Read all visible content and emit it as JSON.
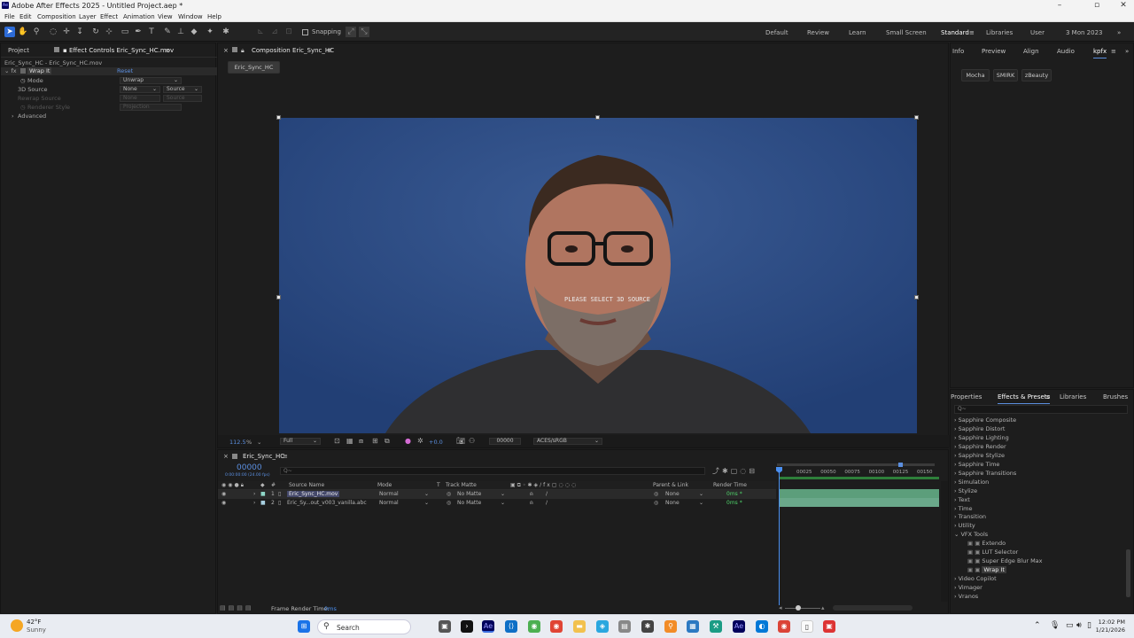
{
  "window": {
    "title": "Adobe After Effects 2025 - Untitled Project.aep *",
    "app_icon": "Ae"
  },
  "menu": [
    "File",
    "Edit",
    "Composition",
    "Layer",
    "Effect",
    "Animation",
    "View",
    "Window",
    "Help"
  ],
  "toolbar": {
    "snapping_label": "Snapping"
  },
  "workspaces": [
    "Default",
    "Review",
    "Learn",
    "Small Screen",
    "Standard",
    "Libraries",
    "User",
    "3 Mon 2023"
  ],
  "active_workspace": "Standard",
  "left_panel": {
    "tabs": [
      "Project",
      "Effect Controls Eric_Sync_HC.mov"
    ],
    "breadcrumb": "Eric_Sync_HC - Eric_Sync_HC.mov",
    "effect_name": "Wrap It",
    "reset_label": "Reset",
    "props": [
      {
        "label": "Mode",
        "value": "Unwrap"
      },
      {
        "label": "3D Source",
        "value": "None",
        "value2": "Source"
      },
      {
        "label": "Rewrap Source",
        "value": "None",
        "value2": "Source"
      },
      {
        "label": "Renderer Style",
        "value": "Projection"
      },
      {
        "label": "Advanced"
      }
    ]
  },
  "comp_panel": {
    "tab": "Composition Eric_Sync_HC",
    "comp_button": "Eric_Sync_HC",
    "overlay_text": "PLEASE SELECT 3D SOURCE",
    "zoom": "112.5",
    "zoom_unit": "%",
    "resolution": "Full",
    "exposure": "+0.0",
    "timecode": "00000",
    "color_space": "ACES/sRGB"
  },
  "right_panel": {
    "tabs": [
      "Info",
      "Preview",
      "Align",
      "Audio",
      "kpfx"
    ],
    "buttons": [
      "Mocha",
      "SMIRK",
      "zBeauty"
    ],
    "lower_tabs": [
      "Properties",
      "Effects & Presets",
      "Libraries",
      "Brushes"
    ],
    "search_placeholder": "Q~",
    "effects_list": [
      {
        "label": "Sapphire Composite",
        "indent": 0
      },
      {
        "label": "Sapphire Distort",
        "indent": 0
      },
      {
        "label": "Sapphire Lighting",
        "indent": 0
      },
      {
        "label": "Sapphire Render",
        "indent": 0
      },
      {
        "label": "Sapphire Stylize",
        "indent": 0
      },
      {
        "label": "Sapphire Time",
        "indent": 0
      },
      {
        "label": "Sapphire Transitions",
        "indent": 0
      },
      {
        "label": "Simulation",
        "indent": 0
      },
      {
        "label": "Stylize",
        "indent": 0
      },
      {
        "label": "Text",
        "indent": 0
      },
      {
        "label": "Time",
        "indent": 0
      },
      {
        "label": "Transition",
        "indent": 0
      },
      {
        "label": "Utility",
        "indent": 0
      },
      {
        "label": "VFX Tools",
        "indent": 0,
        "open": true
      },
      {
        "label": "Extendo",
        "indent": 1
      },
      {
        "label": "LUT Selector",
        "indent": 1
      },
      {
        "label": "Super Edge Blur Max",
        "indent": 1
      },
      {
        "label": "Wrap It",
        "indent": 1,
        "selected": true
      },
      {
        "label": "Video Copilot",
        "indent": 0
      },
      {
        "label": "Vimager",
        "indent": 0
      },
      {
        "label": "Vranos",
        "indent": 0
      }
    ]
  },
  "timeline": {
    "tab": "Eric_Sync_HC",
    "timecode": "00000",
    "sub_timecode": "0:00:00:00 (24.00 fps)",
    "columns": [
      "Source Name",
      "Mode",
      "T",
      "Track Matte",
      "Parent & Link",
      "Render Time"
    ],
    "ruler": [
      "00025",
      "00050",
      "00075",
      "00100",
      "00125",
      "00150"
    ],
    "layers": [
      {
        "num": "1",
        "name": "Eric_Sync_HC.mov",
        "mode": "Normal",
        "matte": "No Matte",
        "parent": "None",
        "render": "0ms *",
        "selected": true
      },
      {
        "num": "2",
        "name": "Eric_Sy...out_v003_vanilla.abc",
        "mode": "Normal",
        "matte": "No Matte",
        "parent": "None",
        "render": "0ms *",
        "selected": false
      }
    ],
    "footer_label": "Frame Render Time:",
    "footer_value": "0ms"
  },
  "taskbar": {
    "weather_temp": "42°F",
    "weather_desc": "Sunny",
    "search_label": "Search",
    "time": "12:02 PM",
    "date": "1/21/2026"
  }
}
